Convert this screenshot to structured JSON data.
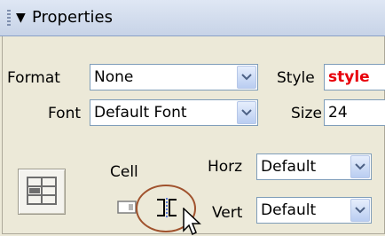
{
  "panel": {
    "title": "Properties",
    "format": {
      "label": "Format",
      "value": "None"
    },
    "style": {
      "label": "Style",
      "value": "style"
    },
    "font": {
      "label": "Font",
      "value": "Default Font"
    },
    "size": {
      "label": "Size",
      "value": "24"
    },
    "cell": {
      "label": "Cell",
      "horz": {
        "label": "Horz",
        "value": "Default"
      },
      "vert": {
        "label": "Vert",
        "value": "Default"
      }
    }
  },
  "icons": {
    "collapse": "triangle-down-icon",
    "cell_properties": "cell-layout-icon",
    "merge": "merge-cells-icon",
    "split": "split-cell-icon"
  },
  "colors": {
    "style_value": "#e8000b",
    "highlight": "#a0522d"
  }
}
